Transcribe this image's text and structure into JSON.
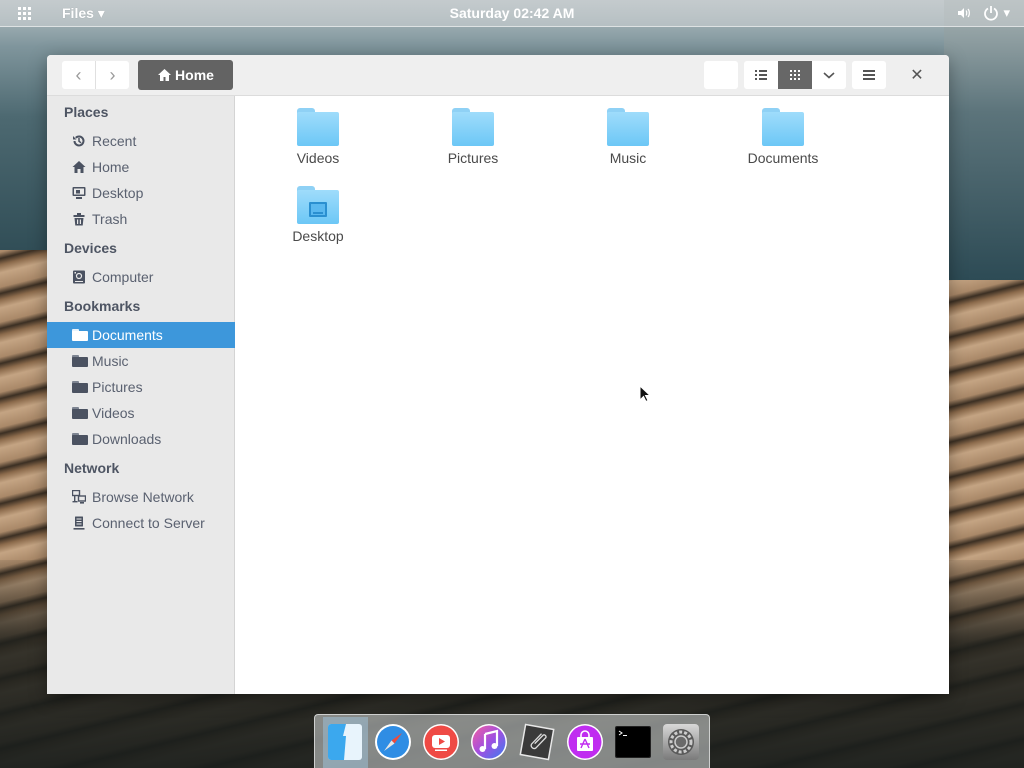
{
  "top_panel": {
    "app_menu": "Files ▾",
    "clock": "Saturday 02:42 AM",
    "icons": [
      "apps-grid-icon",
      "volume-icon",
      "power-icon"
    ],
    "system_menu_arrow": "▾"
  },
  "window": {
    "headerbar": {
      "back_glyph": "‹",
      "forward_glyph": "›",
      "path_label": "Home",
      "close_glyph": "✕",
      "view_mode_active": "grid"
    },
    "sidebar": {
      "sections": [
        {
          "heading": "Places",
          "items": [
            {
              "label": "Recent",
              "icon": "recent-icon"
            },
            {
              "label": "Home",
              "icon": "home-icon"
            },
            {
              "label": "Desktop",
              "icon": "desktop-icon"
            },
            {
              "label": "Trash",
              "icon": "trash-icon"
            }
          ]
        },
        {
          "heading": "Devices",
          "items": [
            {
              "label": "Computer",
              "icon": "computer-icon"
            }
          ]
        },
        {
          "heading": "Bookmarks",
          "items": [
            {
              "label": "Documents",
              "icon": "folder-icon",
              "selected": true
            },
            {
              "label": "Music",
              "icon": "folder-icon"
            },
            {
              "label": "Pictures",
              "icon": "folder-icon"
            },
            {
              "label": "Videos",
              "icon": "folder-icon"
            },
            {
              "label": "Downloads",
              "icon": "folder-icon"
            }
          ]
        },
        {
          "heading": "Network",
          "items": [
            {
              "label": "Browse Network",
              "icon": "network-icon"
            },
            {
              "label": "Connect to Server",
              "icon": "server-icon"
            }
          ]
        }
      ]
    },
    "files": [
      {
        "name": "Videos",
        "icon": "folder-icon"
      },
      {
        "name": "Pictures",
        "icon": "folder-icon"
      },
      {
        "name": "Music",
        "icon": "folder-icon"
      },
      {
        "name": "Documents",
        "icon": "folder-icon"
      },
      {
        "name": "Desktop",
        "icon": "desktop-folder-icon"
      }
    ]
  },
  "dock": {
    "items": [
      {
        "name": "Files",
        "icon": "files-app-icon",
        "running": true
      },
      {
        "name": "Web Browser",
        "icon": "safari-compass-icon",
        "running": false
      },
      {
        "name": "YouTube",
        "icon": "youtube-icon",
        "running": false
      },
      {
        "name": "Music",
        "icon": "itunes-music-icon",
        "running": false
      },
      {
        "name": "Notes",
        "icon": "paperclip-icon",
        "running": false
      },
      {
        "name": "App Store",
        "icon": "app-store-bag-icon",
        "running": true
      },
      {
        "name": "Terminal",
        "icon": "terminal-icon",
        "running": true
      },
      {
        "name": "Settings",
        "icon": "settings-gear-icon",
        "running": false
      }
    ]
  },
  "colors": {
    "accent": "#3d97db",
    "folder": "#6cc7f6",
    "path_button": "#636363",
    "sidebar_bg": "#e9e9e9"
  }
}
